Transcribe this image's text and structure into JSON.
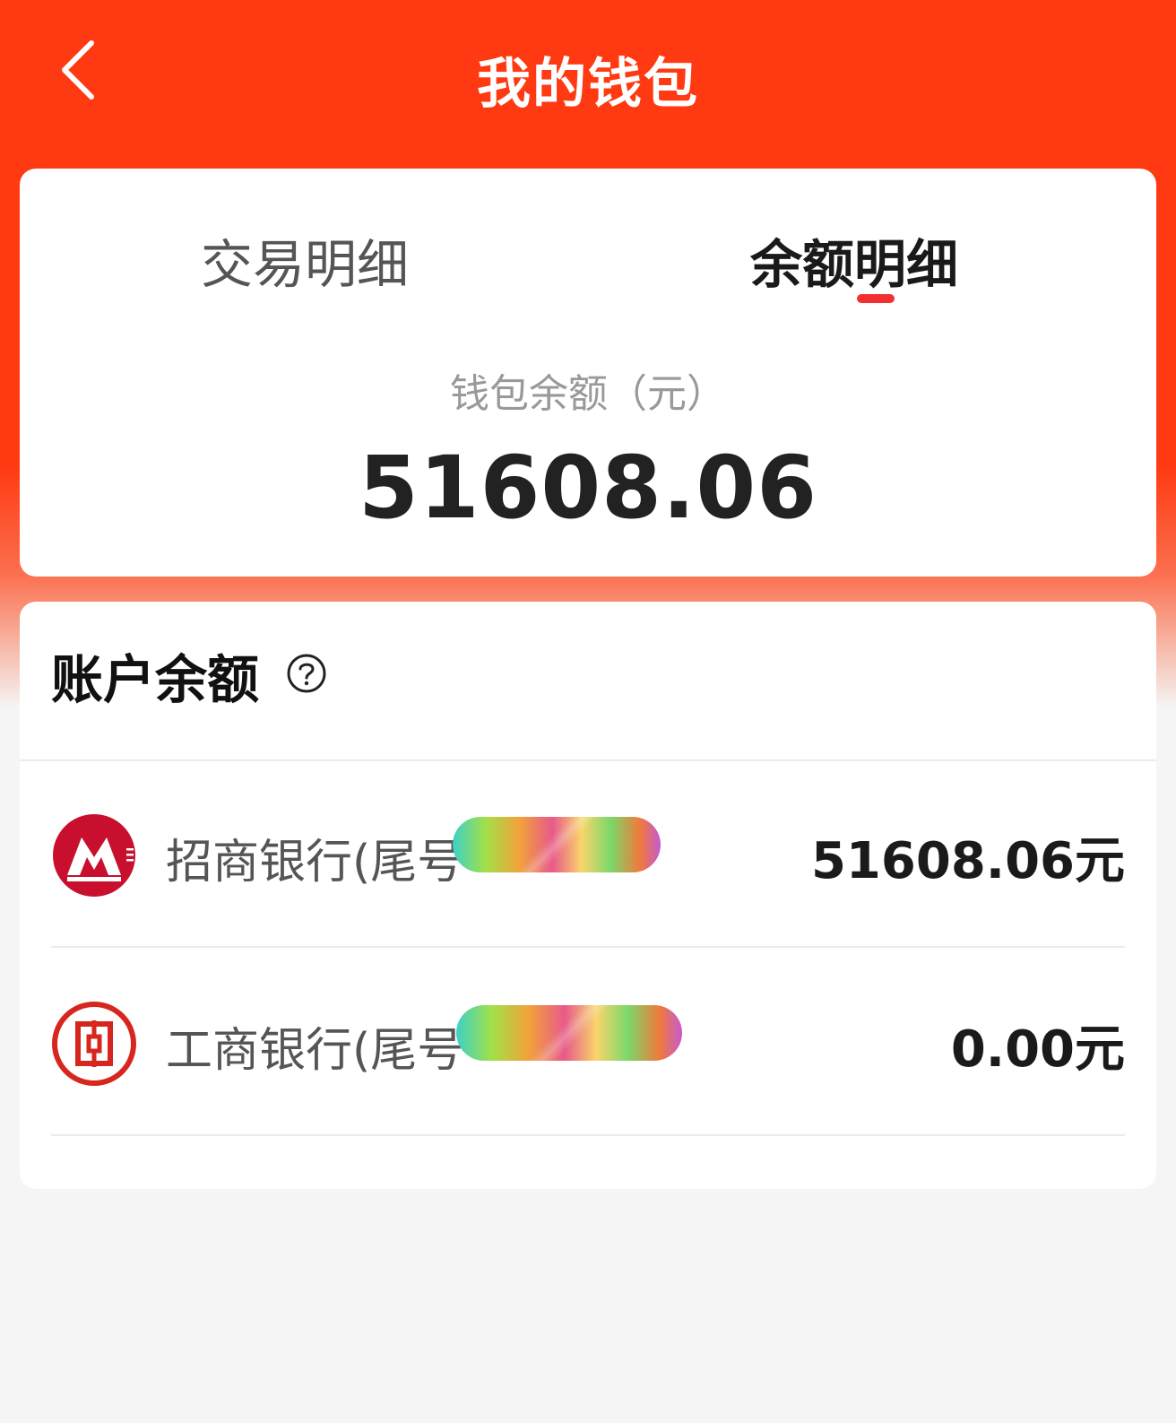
{
  "header": {
    "title": "我的钱包",
    "back_icon": "chevron-left-icon"
  },
  "tabs": [
    {
      "label": "交易明细",
      "active": false
    },
    {
      "label": "余额明细",
      "active": true
    }
  ],
  "wallet": {
    "balance_label": "钱包余额（元）",
    "balance_value": "51608.06"
  },
  "accounts_section": {
    "title": "账户余额",
    "help_icon": "question-circle-icon",
    "accounts": [
      {
        "bank_name": "招商银行(尾号",
        "amount": "51608.06元",
        "logo_icon": "cmb-bank-logo-icon",
        "logo_color": "#c8102e"
      },
      {
        "bank_name": "工商银行(尾号",
        "amount": "0.00元",
        "logo_icon": "icbc-bank-logo-icon",
        "logo_color": "#d7261e"
      }
    ]
  },
  "colors": {
    "header_bg": "#ff3a12",
    "tab_indicator": "#f23030",
    "page_bg": "#f5f5f5"
  }
}
